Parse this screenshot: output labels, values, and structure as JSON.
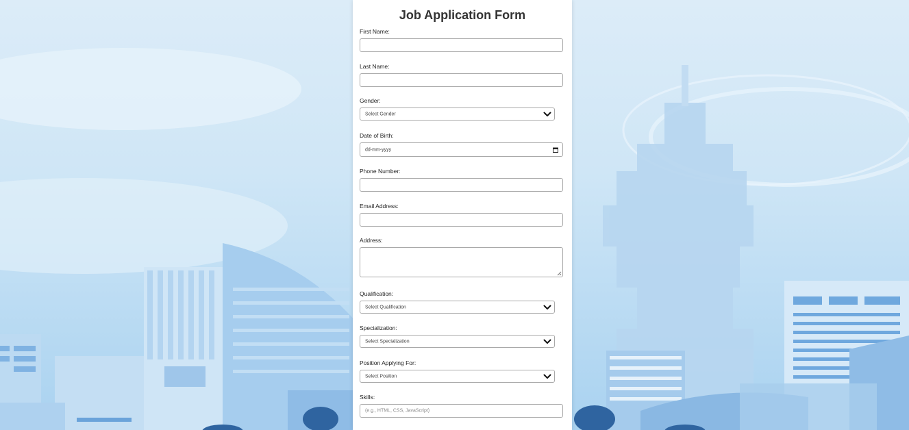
{
  "form": {
    "title": "Job Application Form",
    "first_name": {
      "label": "First Name:",
      "value": ""
    },
    "last_name": {
      "label": "Last Name:",
      "value": ""
    },
    "gender": {
      "label": "Gender:",
      "selected": "Select Gender"
    },
    "dob": {
      "label": "Date of Birth:",
      "placeholder": "dd-mm-yyyy"
    },
    "phone": {
      "label": "Phone Number:",
      "value": ""
    },
    "email": {
      "label": "Email Address:",
      "value": ""
    },
    "address": {
      "label": "Address:",
      "value": ""
    },
    "qualification": {
      "label": "Qualification:",
      "selected": "Select Qualification"
    },
    "specialization": {
      "label": "Specialization:",
      "selected": "Select Specialization"
    },
    "position": {
      "label": "Position Applying For:",
      "selected": "Select Position"
    },
    "skills": {
      "label": "Skills:",
      "placeholder": "(e.g., HTML, CSS, JavaScript)"
    }
  },
  "colors": {
    "card_bg": "#ffffff",
    "title": "#333333",
    "input_border": "#a9a9a9",
    "sky": "#cfe6f6",
    "building": "#9cc8ec",
    "building_dark": "#2f64a0"
  }
}
